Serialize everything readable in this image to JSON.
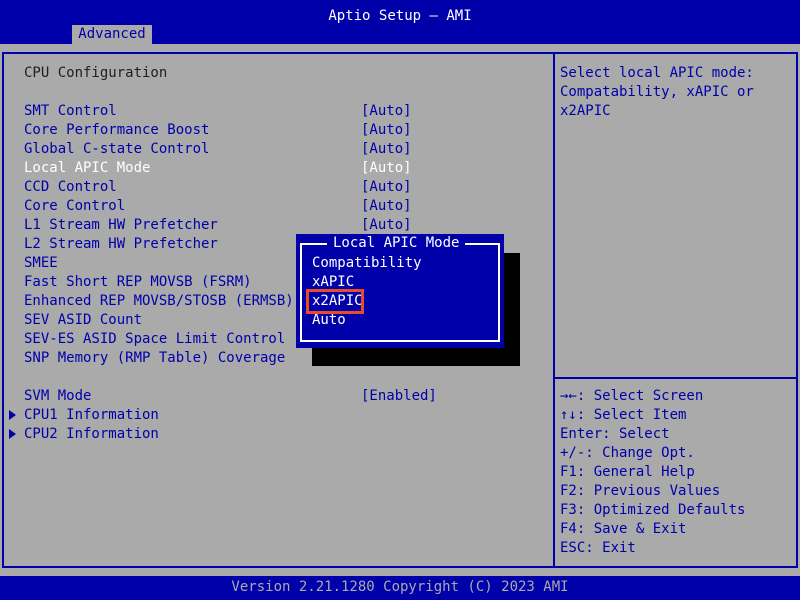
{
  "header": {
    "title": "Aptio Setup – AMI",
    "tab_label": "Advanced"
  },
  "main": {
    "section_title": "CPU Configuration",
    "items": [
      {
        "label": "SMT Control",
        "value": "[Auto]"
      },
      {
        "label": "Core Performance Boost",
        "value": "[Auto]"
      },
      {
        "label": "Global C-state Control",
        "value": "[Auto]"
      },
      {
        "label": "Local APIC Mode",
        "value": "[Auto]"
      },
      {
        "label": "CCD Control",
        "value": "[Auto]"
      },
      {
        "label": "Core Control",
        "value": "[Auto]"
      },
      {
        "label": "L1 Stream HW Prefetcher",
        "value": "[Auto]"
      },
      {
        "label": "L2 Stream HW Prefetcher",
        "value": ""
      },
      {
        "label": "SMEE",
        "value": ""
      },
      {
        "label": "Fast Short REP MOVSB (FSRM)",
        "value": ""
      },
      {
        "label": "Enhanced REP MOVSB/STOSB (ERMSB)",
        "value": ""
      },
      {
        "label": "SEV ASID Count",
        "value": ""
      },
      {
        "label": "SEV-ES ASID Space Limit Control",
        "value": ""
      },
      {
        "label": "SNP Memory (RMP Table) Coverage",
        "value": ""
      }
    ],
    "svm": {
      "label": "SVM Mode",
      "value": "[Enabled]"
    },
    "submenus": [
      {
        "label": "CPU1 Information"
      },
      {
        "label": "CPU2 Information"
      }
    ]
  },
  "help": {
    "lines": [
      "Select local APIC mode:",
      "Compatability, xAPIC or",
      "x2APIC"
    ],
    "keys": [
      "→←: Select Screen",
      "↑↓: Select Item",
      "Enter: Select",
      "+/-: Change Opt.",
      "F1: General Help",
      "F2: Previous Values",
      "F3: Optimized Defaults",
      "F4: Save & Exit",
      "ESC: Exit"
    ]
  },
  "popup": {
    "title": "Local APIC Mode",
    "options": [
      "Compatibility",
      "xAPIC",
      "x2APIC",
      "Auto"
    ],
    "highlighted_option": "x2APIC"
  },
  "footer": {
    "text": "Version 2.21.1280 Copyright (C) 2023 AMI"
  },
  "colors": {
    "bios_blue": "#0000aa",
    "panel_gray": "#aaaaaa",
    "text_white": "#ffffff",
    "highlight_box": "#e84a2a"
  }
}
